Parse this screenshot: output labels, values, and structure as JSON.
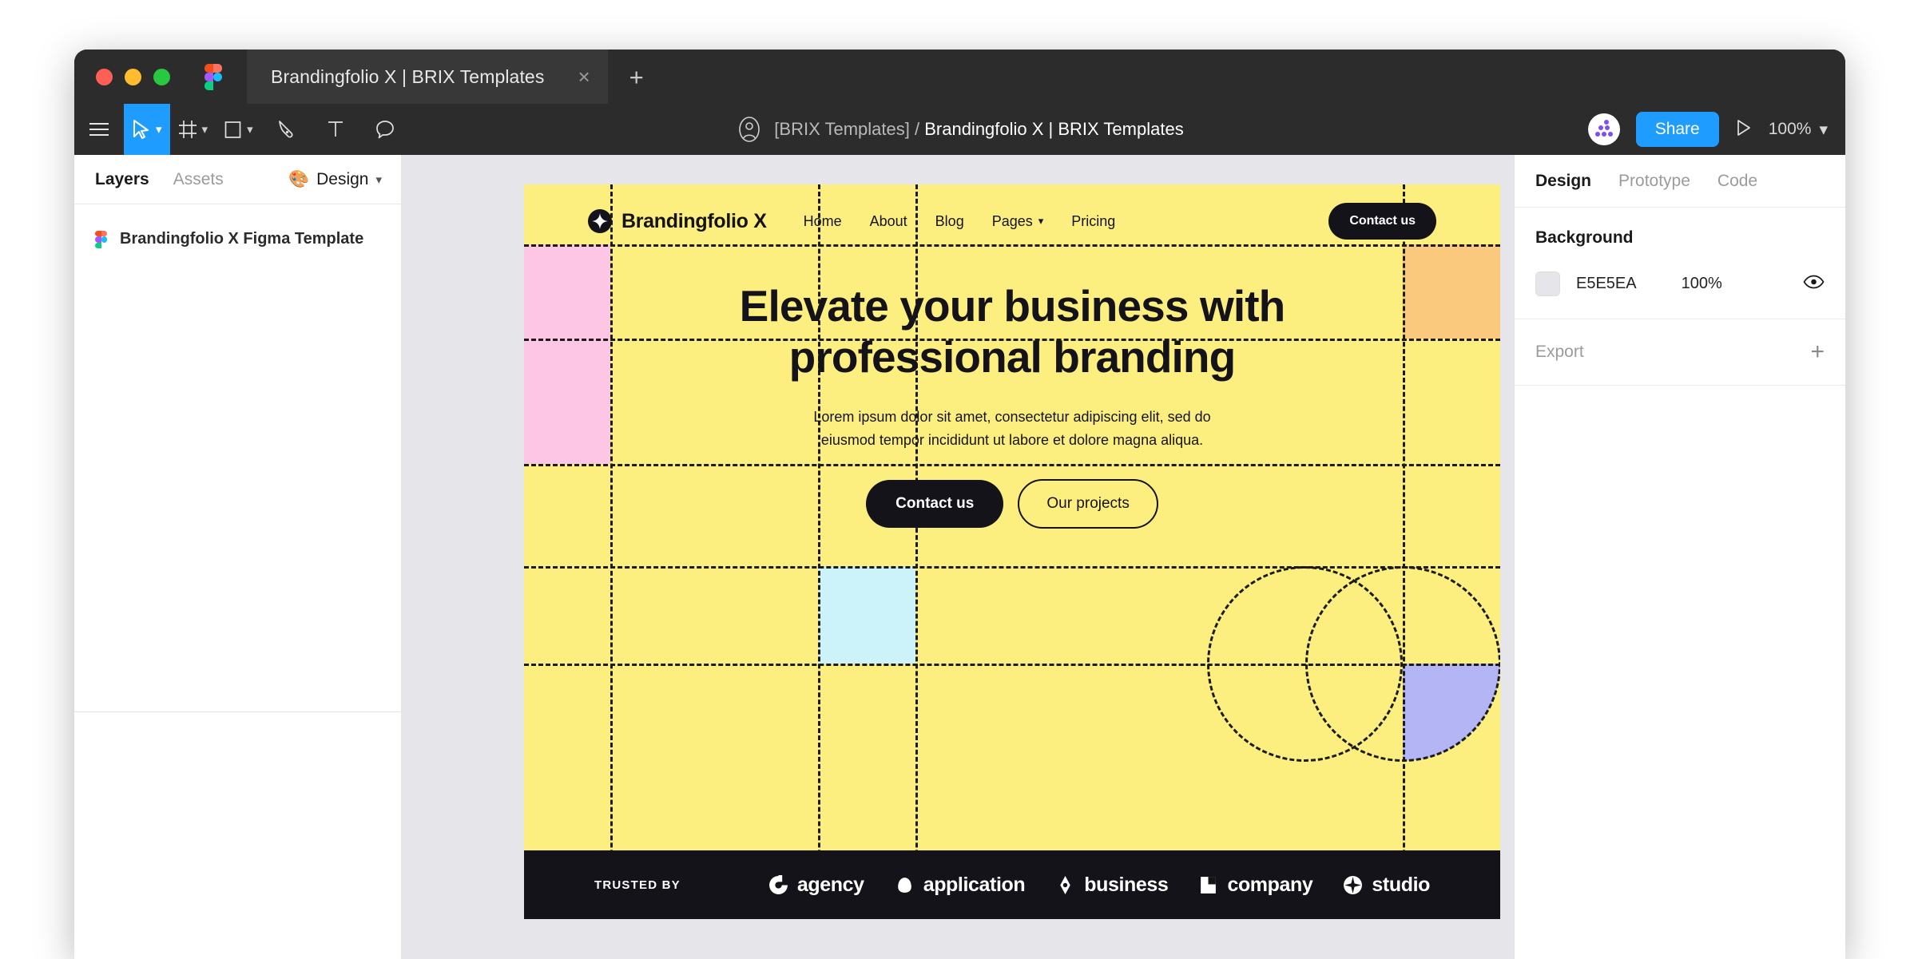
{
  "window": {
    "traffic_lights": [
      "close",
      "minimize",
      "maximize"
    ],
    "tab_title": "Brandingfolio X | BRIX Templates",
    "tab_close": "×",
    "new_tab": "+"
  },
  "toolbar": {
    "tools": [
      {
        "name": "menu-icon",
        "label": "Menu"
      },
      {
        "name": "move-tool-icon",
        "label": "Move",
        "active": true,
        "has_caret": true
      },
      {
        "name": "frame-tool-icon",
        "label": "Frame",
        "has_caret": true
      },
      {
        "name": "shape-tool-icon",
        "label": "Rectangle",
        "has_caret": true
      },
      {
        "name": "pen-tool-icon",
        "label": "Pen"
      },
      {
        "name": "text-tool-icon",
        "label": "Text"
      },
      {
        "name": "comment-tool-icon",
        "label": "Comment"
      }
    ],
    "breadcrumb_team": "[BRIX Templates]",
    "breadcrumb_separator": "/",
    "breadcrumb_file": "Brandingfolio X | BRIX Templates",
    "share_label": "Share",
    "zoom_level": "100%",
    "zoom_caret": "⌄"
  },
  "left_panel": {
    "tabs": [
      {
        "label": "Layers",
        "active": true
      },
      {
        "label": "Assets",
        "active": false
      }
    ],
    "mode_dropdown": {
      "emoji": "🎨",
      "label": "Design",
      "caret": "⌄"
    },
    "layers": [
      {
        "label": "Brandingfolio X Figma Template"
      }
    ]
  },
  "right_panel": {
    "tabs": [
      {
        "label": "Design",
        "active": true
      },
      {
        "label": "Prototype",
        "active": false
      },
      {
        "label": "Code",
        "active": false
      }
    ],
    "background": {
      "title": "Background",
      "hex": "E5E5EA",
      "opacity": "100%",
      "color": "#E5E5EA"
    },
    "export": {
      "label": "Export",
      "add": "+"
    }
  },
  "canvas": {
    "background_color": "#E5E5EA",
    "frame": {
      "fill": "#FCEF7F",
      "site_header": {
        "brand": "Brandingfolio X",
        "nav": [
          {
            "label": "Home",
            "has_caret": false
          },
          {
            "label": "About",
            "has_caret": false
          },
          {
            "label": "Blog",
            "has_caret": false
          },
          {
            "label": "Pages",
            "has_caret": true,
            "caret": "⌄"
          },
          {
            "label": "Pricing",
            "has_caret": false
          }
        ],
        "cta": "Contact us"
      },
      "hero": {
        "heading": "Elevate your business with professional branding",
        "paragraph": "Lorem ipsum dolor sit amet, consectetur adipiscing elit, sed do eiusmod tempor incididunt ut labore et dolore magna aliqua.",
        "primary_cta": "Contact us",
        "secondary_cta": "Our projects"
      },
      "trusted": {
        "label": "TRUSTED BY",
        "logos": [
          {
            "name": "agency",
            "glyph": "agency-logo-icon"
          },
          {
            "name": "application",
            "glyph": "application-logo-icon"
          },
          {
            "name": "business",
            "glyph": "business-logo-icon"
          },
          {
            "name": "company",
            "glyph": "company-logo-icon"
          },
          {
            "name": "studio",
            "glyph": "studio-logo-icon"
          }
        ]
      },
      "swatches": [
        {
          "name": "pink-rectangle",
          "color": "#FCC6E4"
        },
        {
          "name": "orange-rectangle",
          "color": "#FBC97E"
        },
        {
          "name": "light-blue-square",
          "color": "#CCF3F9"
        },
        {
          "name": "purple-quarter-circle",
          "color": "#B3B5F5"
        }
      ]
    }
  }
}
